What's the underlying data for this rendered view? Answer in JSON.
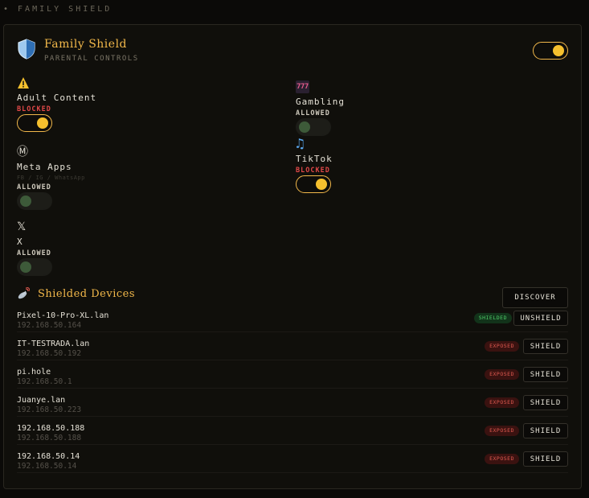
{
  "topbar": {
    "label": "• FAMILY SHIELD"
  },
  "header": {
    "title": "Family Shield",
    "subtitle": "PARENTAL CONTROLS",
    "master_enabled": true
  },
  "categories": [
    {
      "name": "Adult Content",
      "icon": "warning-icon",
      "glyph": "⚠",
      "status": "BLOCKED",
      "enabled": true
    },
    {
      "name": "Gambling",
      "icon": "slot-machine-icon",
      "glyph": "777",
      "status": "ALLOWED",
      "enabled": false
    },
    {
      "name": "Meta Apps",
      "icon": "meta-icon",
      "glyph": "Ⓜ",
      "subtitle": "FB / IG / WhatsApp",
      "status": "ALLOWED",
      "enabled": false
    },
    {
      "name": "TikTok",
      "icon": "music-note-icon",
      "glyph": "♫",
      "status": "BLOCKED",
      "enabled": true
    },
    {
      "name": "X",
      "icon": "x-logo-icon",
      "glyph": "𝕏",
      "status": "ALLOWED",
      "enabled": false
    }
  ],
  "devices_section": {
    "title": "Shielded Devices",
    "icon": "satellite-icon",
    "discover_label": "DISCOVER"
  },
  "devices": [
    {
      "name": "Pixel-10-Pro-XL.lan",
      "ip": "192.168.50.164",
      "badge": "SHIELDED",
      "action": "UNSHIELD"
    },
    {
      "name": "IT-TESTRADA.lan",
      "ip": "192.168.50.192",
      "badge": "EXPOSED",
      "action": "SHIELD"
    },
    {
      "name": "pi.hole",
      "ip": "192.168.50.1",
      "badge": "EXPOSED",
      "action": "SHIELD"
    },
    {
      "name": "Juanye.lan",
      "ip": "192.168.50.223",
      "badge": "EXPOSED",
      "action": "SHIELD"
    },
    {
      "name": "192.168.50.188",
      "ip": "192.168.50.188",
      "badge": "EXPOSED",
      "action": "SHIELD"
    },
    {
      "name": "192.168.50.14",
      "ip": "192.168.50.14",
      "badge": "EXPOSED",
      "action": "SHIELD"
    }
  ],
  "colors": {
    "accent": "#f2b84a",
    "blocked": "#e04848",
    "shielded": "#4fcf6a",
    "exposed": "#e05a50"
  }
}
